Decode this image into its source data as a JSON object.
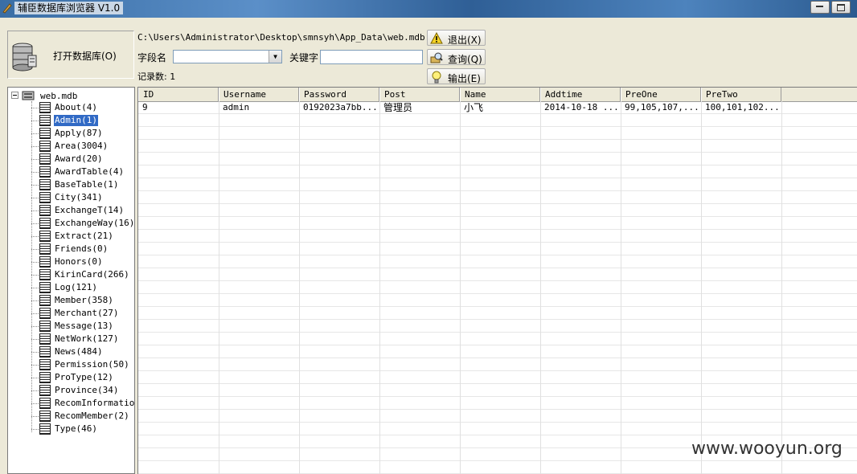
{
  "window": {
    "title": "辅臣数据库浏览器 V1.0"
  },
  "toolbar": {
    "open_db_label": "打开数据库(O)",
    "db_path": "C:\\Users\\Administrator\\Desktop\\smnsyh\\App_Data\\web.mdb",
    "field_label": "字段名",
    "field_value": "",
    "keyword_label": "关键字",
    "keyword_value": "",
    "record_count": "记录数: 1",
    "exit_label": "退出(X)",
    "query_label": "查询(Q)",
    "export_label": "输出(E)"
  },
  "tree": {
    "root": "web.mdb",
    "items": [
      "About(4)",
      "Admin(1)",
      "Apply(87)",
      "Area(3004)",
      "Award(20)",
      "AwardTable(4)",
      "BaseTable(1)",
      "City(341)",
      "ExchangeT(14)",
      "ExchangeWay(16)",
      "Extract(21)",
      "Friends(0)",
      "Honors(0)",
      "KirinCard(266)",
      "Log(121)",
      "Member(358)",
      "Merchant(27)",
      "Message(13)",
      "NetWork(127)",
      "News(484)",
      "Permission(50)",
      "ProType(12)",
      "Province(34)",
      "RecomInformation",
      "RecomMember(2)",
      "Type(46)"
    ],
    "selected_index": 1
  },
  "grid": {
    "columns": [
      "ID",
      "Username",
      "Password",
      "Post",
      "Name",
      "Addtime",
      "PreOne",
      "PreTwo"
    ],
    "rows": [
      [
        "9",
        "admin",
        "0192023a7bb...",
        "管理员",
        "小飞",
        "2014-10-18 ...",
        "99,105,107,...",
        "100,101,102..."
      ]
    ]
  },
  "watermark": "www.wooyun.org"
}
